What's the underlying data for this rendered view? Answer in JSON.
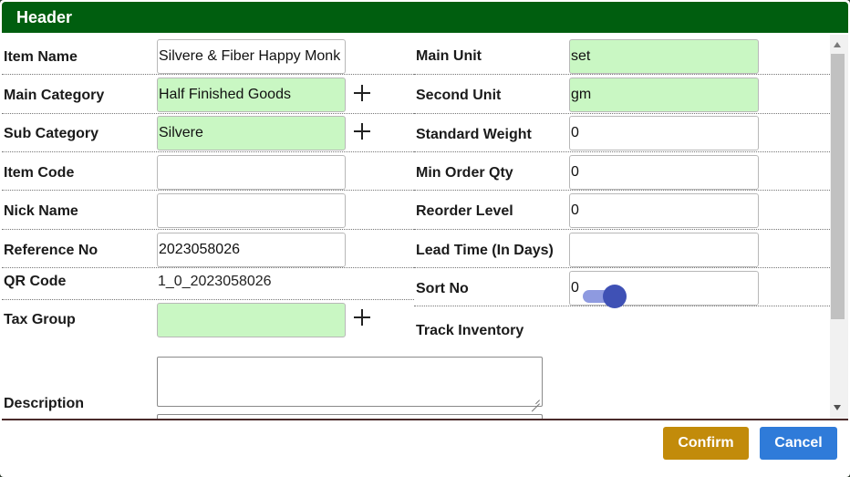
{
  "header": {
    "title": "Header"
  },
  "left": {
    "item_name_label": "Item Name",
    "item_name_value": "Silvere & Fiber Happy Monk",
    "main_category_label": "Main Category",
    "main_category_value": "Half Finished Goods",
    "sub_category_label": "Sub Category",
    "sub_category_value": "Silvere",
    "item_code_label": "Item Code",
    "item_code_value": "",
    "nick_name_label": "Nick Name",
    "nick_name_value": "",
    "reference_no_label": "Reference No",
    "reference_no_value": "2023058026",
    "qr_code_label": "QR Code",
    "qr_code_value": "1_0_2023058026",
    "tax_group_label": "Tax Group",
    "tax_group_value": "",
    "description_label": "Description"
  },
  "right": {
    "main_unit_label": "Main Unit",
    "main_unit_value": "set",
    "second_unit_label": "Second Unit",
    "second_unit_value": "gm",
    "standard_weight_label": "Standard Weight",
    "standard_weight_value": "0",
    "min_order_qty_label": "Min Order Qty",
    "min_order_qty_value": "0",
    "reorder_level_label": "Reorder Level",
    "reorder_level_value": "0",
    "lead_time_label": "Lead Time (In Days)",
    "lead_time_value": "",
    "sort_no_label": "Sort No",
    "sort_no_value": "0",
    "track_inventory_label": "Track Inventory",
    "track_inventory_on": true
  },
  "footer": {
    "confirm_label": "Confirm",
    "cancel_label": "Cancel"
  },
  "colors": {
    "header": "#005e0f",
    "field_green": "#c9f7c3",
    "confirm": "#c28b0a",
    "cancel": "#2f7bd9",
    "toggle": "#3f51b5"
  }
}
